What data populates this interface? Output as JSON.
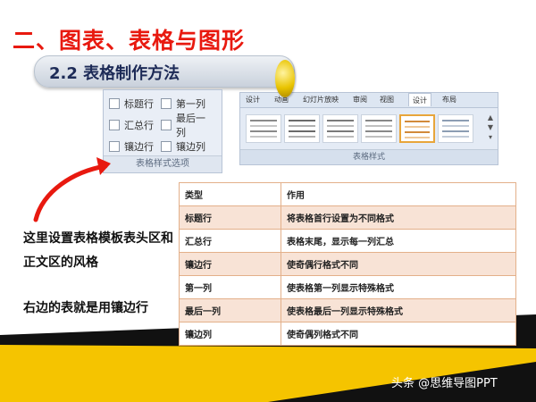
{
  "title": "二、图表、表格与图形",
  "section": "2.2 表格制作方法",
  "options_panel": {
    "items": [
      {
        "label": "标题行",
        "checked": false
      },
      {
        "label": "第一列",
        "checked": false
      },
      {
        "label": "汇总行",
        "checked": false
      },
      {
        "label": "最后一列",
        "checked": false
      },
      {
        "label": "镶边行",
        "checked": false
      },
      {
        "label": "镶边列",
        "checked": false
      }
    ],
    "footer": "表格样式选项"
  },
  "ribbon": {
    "tabs": [
      "设计",
      "动画",
      "幻灯片放映",
      "审阅",
      "视图",
      "设计",
      "布局"
    ],
    "active_tab_index": 5,
    "thumb_count": 6,
    "selected_thumb_index": 4,
    "footer": "表格样式"
  },
  "table": {
    "header": [
      "类型",
      "作用"
    ],
    "rows": [
      [
        "标题行",
        "将表格首行设置为不同格式"
      ],
      [
        "汇总行",
        "表格末尾，显示每一列汇总"
      ],
      [
        "镶边行",
        "使奇偶行格式不同"
      ],
      [
        "第一列",
        "使表格第一列显示特殊格式"
      ],
      [
        "最后一列",
        "使表格最后一列显示特殊格式"
      ],
      [
        "镶边列",
        "使奇偶列格式不同"
      ]
    ]
  },
  "notes": {
    "line1": "这里设置表格模板表头区和正文区的风格",
    "line2": "右边的表就是用镶边行"
  },
  "watermark": "头条 @思维导图PPT",
  "colors": {
    "title": "#e8190f",
    "arrow": "#e8190f",
    "band_black": "#111111",
    "band_yellow": "#f5c400",
    "row_shade": "#f8e3d6",
    "selected_thumb_border": "#e8a53a"
  }
}
